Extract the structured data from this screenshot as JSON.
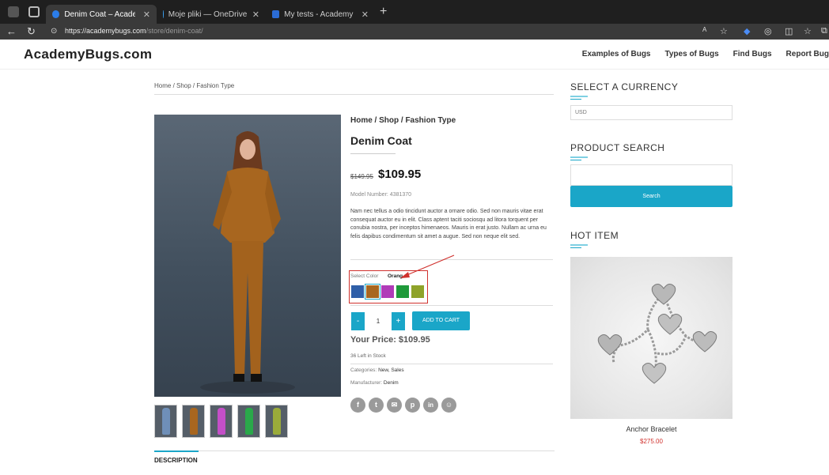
{
  "browser": {
    "tabs": [
      {
        "title": "Denim Coat – AcademyBugs.com",
        "favicon_color": "#2b7de9"
      },
      {
        "title": "Moje pliki — OneDrive",
        "favicon_color": "#3aa0f0"
      },
      {
        "title": "My tests - AcademyBugs.docx -",
        "favicon_color": "#2b6cd6"
      }
    ],
    "url_host": "https://academybugs.com",
    "url_path": "/store/denim-coat/"
  },
  "site": {
    "logo": "AcademyBugs.com",
    "nav": [
      "Examples of Bugs",
      "Types of Bugs",
      "Find Bugs",
      "Report Bug"
    ]
  },
  "page": {
    "breadcrumb": "Home / Shop / Fashion Type",
    "description_tab": "DESCRIPTION"
  },
  "product": {
    "breadcrumb": "Home / Shop / Fashion Type",
    "title": "Denim Coat",
    "old_price": "$149.95",
    "price": "$109.95",
    "model": "Model Number: 4381370",
    "description": "Nam nec tellus a odio tincidunt auctor a ornare odio. Sed non mauris vitae erat consequat auctor eu in elit. Class aptent taciti sociosqu ad litora torquent per conubia nostra, per inceptos himenaeos. Mauris in erat justo. Nullam ac urna eu felis dapibus condimentum sit amet a augue. Sed non neque elit sed.",
    "color_label": "Select Color",
    "color_value": "Orang",
    "swatches": [
      {
        "name": "blue",
        "color": "#2f5fa8"
      },
      {
        "name": "orange",
        "color": "#a8661f"
      },
      {
        "name": "pink",
        "color": "#b03bb8"
      },
      {
        "name": "green",
        "color": "#1f9a3a"
      },
      {
        "name": "lime",
        "color": "#8fa32a"
      }
    ],
    "qty_minus": "-",
    "qty_value": "1",
    "qty_plus": "+",
    "add_to_cart": "ADD TO CART",
    "your_price": "Your Price: $109.95",
    "stock": "36 Left in Stock",
    "categories_label": "Categories:",
    "categories": "New, Sales",
    "manufacturer_label": "Manufacturer:",
    "manufacturer": "Denim",
    "thumb_colors": [
      "#6f8fb8",
      "#a8661f",
      "#c44fc8",
      "#2aa84a",
      "#9aab3a"
    ],
    "social": [
      "f",
      "t",
      "✉",
      "p",
      "in",
      "☺"
    ]
  },
  "sidebar": {
    "currency_heading": "SELECT A CURRENCY",
    "currency_value": "USD",
    "search_heading": "PRODUCT SEARCH",
    "search_button": "Search",
    "hot_heading": "HOT ITEM",
    "hot_name": "Anchor Bracelet",
    "hot_price": "$275.00"
  }
}
